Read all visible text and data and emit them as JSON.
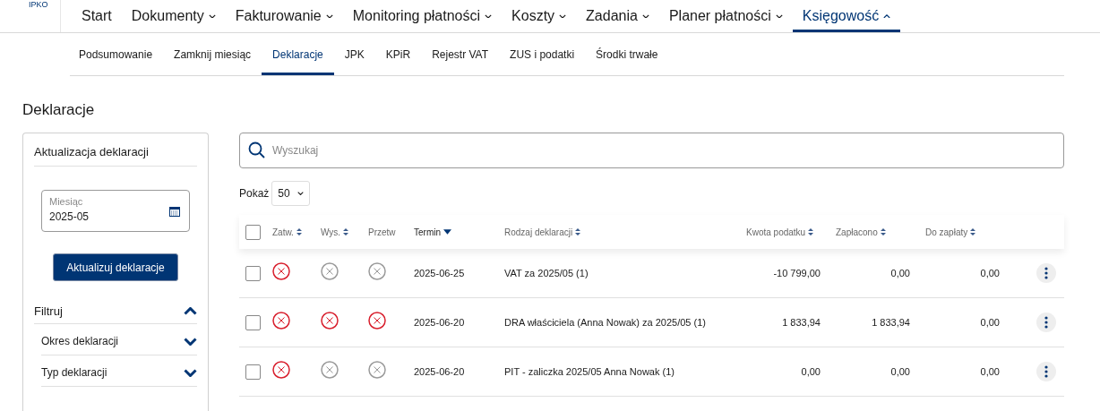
{
  "logo": "IPKO",
  "main_nav": [
    {
      "label": "Start",
      "has_menu": false,
      "selected": false
    },
    {
      "label": "Dokumenty",
      "has_menu": true,
      "selected": false
    },
    {
      "label": "Fakturowanie",
      "has_menu": true,
      "selected": false
    },
    {
      "label": "Monitoring płatności",
      "has_menu": true,
      "selected": false
    },
    {
      "label": "Koszty",
      "has_menu": true,
      "selected": false
    },
    {
      "label": "Zadania",
      "has_menu": true,
      "selected": false
    },
    {
      "label": "Planer płatności",
      "has_menu": true,
      "selected": false
    },
    {
      "label": "Księgowość",
      "has_menu": true,
      "selected": true
    }
  ],
  "sub_nav": [
    {
      "label": "Podsumowanie",
      "selected": false
    },
    {
      "label": "Zamknij miesiąc",
      "selected": false
    },
    {
      "label": "Deklaracje",
      "selected": true
    },
    {
      "label": "JPK",
      "selected": false
    },
    {
      "label": "KPiR",
      "selected": false
    },
    {
      "label": "Rejestr VAT",
      "selected": false
    },
    {
      "label": "ZUS i podatki",
      "selected": false
    },
    {
      "label": "Środki trwałe",
      "selected": false
    }
  ],
  "page_title": "Deklaracje",
  "sidebar": {
    "title": "Aktualizacja deklaracji",
    "month_field": {
      "label": "Miesiąc",
      "value": "2025-05"
    },
    "update_button": "Aktualizuj deklaracje",
    "filter": {
      "title": "Filtruj",
      "expanded": true,
      "sections": [
        {
          "label": "Okres deklaracji",
          "expanded": false
        },
        {
          "label": "Typ deklaracji",
          "expanded": false
        }
      ]
    }
  },
  "search": {
    "placeholder": "Wyszukaj"
  },
  "page_size": {
    "label": "Pokaż",
    "value": "50"
  },
  "table": {
    "select_all_checked": false,
    "columns": [
      {
        "label": "Zatw.",
        "sortable": true,
        "sorted": false
      },
      {
        "label": "Wys.",
        "sortable": true,
        "sorted": false
      },
      {
        "label": "Przetw",
        "sortable": false,
        "sorted": false
      },
      {
        "label": "Termin",
        "sortable": true,
        "sorted": true
      },
      {
        "label": "Rodzaj deklaracji",
        "sortable": true,
        "sorted": false
      },
      {
        "label": "Kwota podatku",
        "sortable": true,
        "sorted": false
      },
      {
        "label": "Zapłacono",
        "sortable": true,
        "sorted": false
      },
      {
        "label": "Do zapłaty",
        "sortable": true,
        "sorted": false
      }
    ],
    "rows": [
      {
        "checked": false,
        "statuses": [
          {
            "alert": true
          },
          {
            "alert": false
          },
          {
            "alert": false
          }
        ],
        "deadline": "2025-06-25",
        "type": "VAT za 2025/05 (1)",
        "tax": "-10 799,00",
        "paid": "0,00",
        "due": "0,00"
      },
      {
        "checked": false,
        "statuses": [
          {
            "alert": true
          },
          {
            "alert": true
          },
          {
            "alert": true
          }
        ],
        "deadline": "2025-06-20",
        "type": "DRA właściciela (Anna Nowak) za 2025/05 (1)",
        "tax": "1 833,94",
        "paid": "1 833,94",
        "due": "0,00"
      },
      {
        "checked": false,
        "statuses": [
          {
            "alert": true
          },
          {
            "alert": false
          },
          {
            "alert": false
          }
        ],
        "deadline": "2025-06-20",
        "type": "PIT - zaliczka 2025/05 Anna Nowak (1)",
        "tax": "0,00",
        "paid": "0,00",
        "due": "0,00"
      }
    ]
  }
}
